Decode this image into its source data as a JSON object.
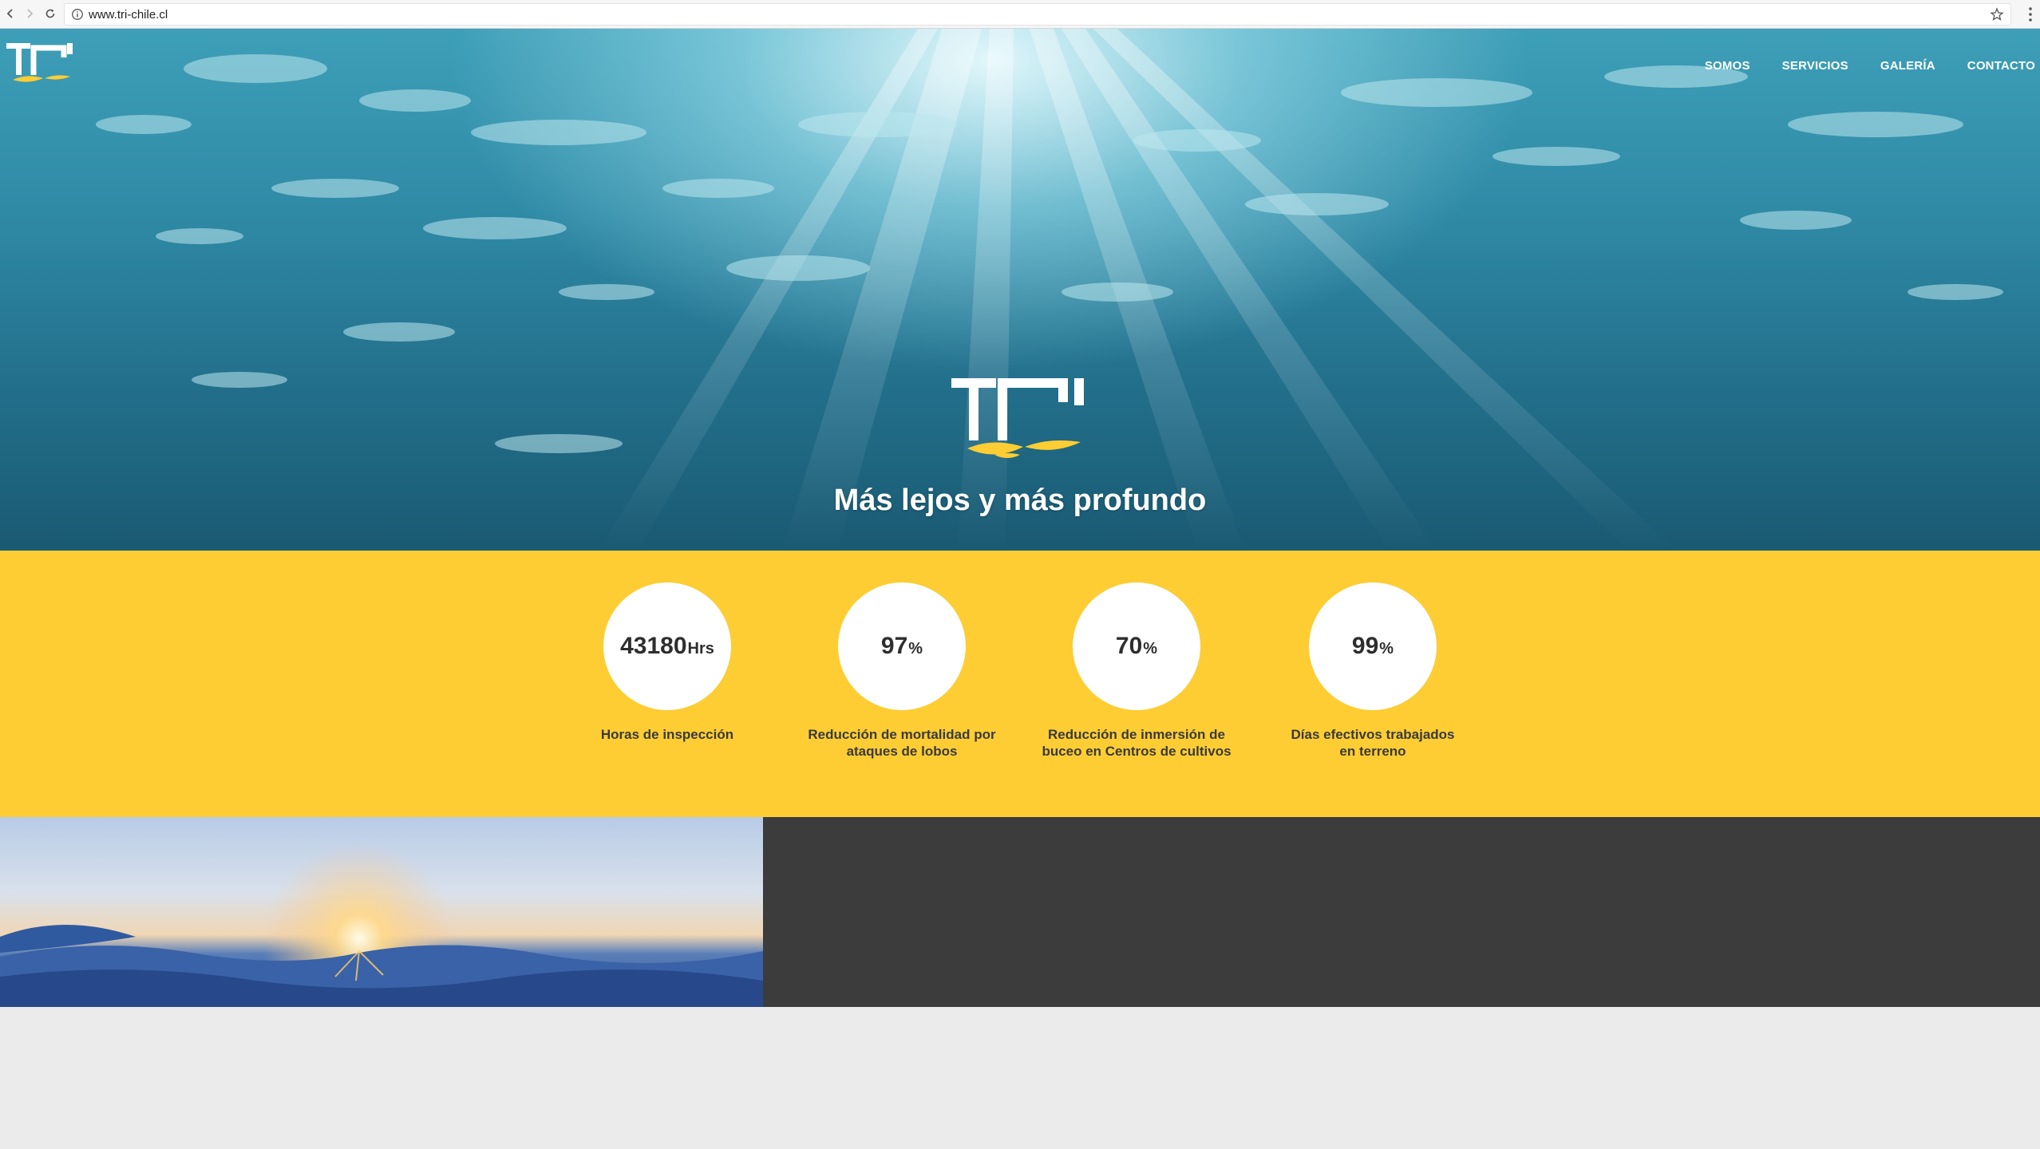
{
  "browser": {
    "url": "www.tri-chile.cl",
    "icons": [
      "back-icon",
      "forward-icon",
      "reload-icon",
      "info-icon",
      "star-icon",
      "menu-icon"
    ]
  },
  "header": {
    "logo_text": "TRI",
    "nav": [
      {
        "label": "SOMOS"
      },
      {
        "label": "SERVICIOS"
      },
      {
        "label": "GALERÍA"
      },
      {
        "label": "CONTACTO"
      }
    ]
  },
  "hero": {
    "logo_text": "TRI",
    "tagline": "Más lejos y más profundo"
  },
  "stats": [
    {
      "value": "43180",
      "unit": "Hrs",
      "label": "Horas de inspección"
    },
    {
      "value": "97",
      "unit": "%",
      "label": "Reducción de mortalidad por ataques de lobos"
    },
    {
      "value": "70",
      "unit": "%",
      "label": "Reducción de inmersión de buceo en Centros de cultivos"
    },
    {
      "value": "99",
      "unit": "%",
      "label": "Días efectivos trabajados en terreno"
    }
  ],
  "colors": {
    "accent_yellow": "#fecd33",
    "dark_panel": "#3c3c3c",
    "page_bg": "#ebebeb",
    "text_dark": "#2e2e2e"
  }
}
